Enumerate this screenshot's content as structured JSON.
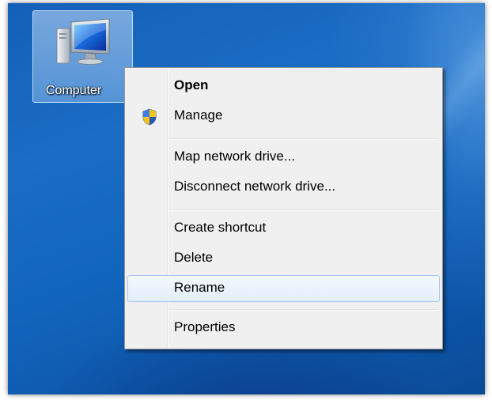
{
  "desktop": {
    "icon": {
      "label": "Computer",
      "icon_name": "computer-monitor-icon"
    }
  },
  "context_menu": {
    "items": [
      {
        "label": "Open",
        "bold": true
      },
      {
        "label": "Manage",
        "icon_name": "uac-shield-icon"
      },
      {
        "label": "Map network drive..."
      },
      {
        "label": "Disconnect network drive..."
      },
      {
        "label": "Create shortcut"
      },
      {
        "label": "Delete"
      },
      {
        "label": "Rename",
        "highlighted": true
      },
      {
        "label": "Properties"
      }
    ]
  },
  "colors": {
    "desktop_blue": "#1565bd",
    "menu_background": "#f0f0f0",
    "menu_border": "#979797",
    "highlight_border": "#a8c6ea",
    "highlight_fill": "#e4eefb"
  }
}
